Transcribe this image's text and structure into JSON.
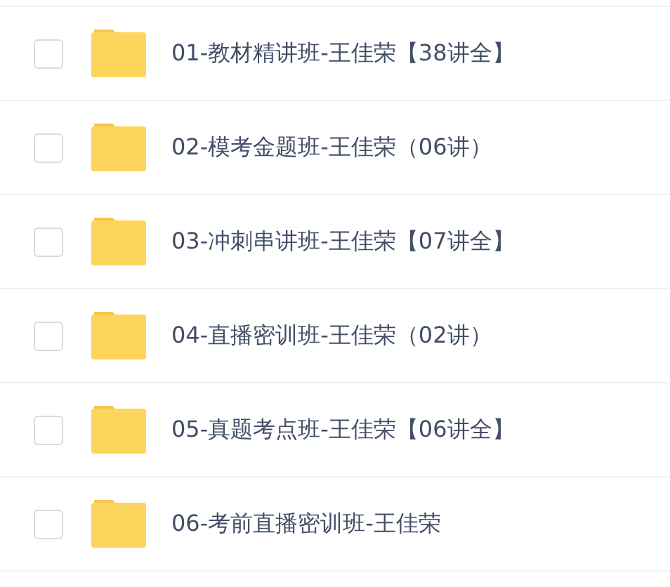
{
  "files": [
    {
      "name": "01-教材精讲班-王佳荣【38讲全】",
      "checked": false
    },
    {
      "name": "02-模考金题班-王佳荣（06讲）",
      "checked": false
    },
    {
      "name": "03-冲刺串讲班-王佳荣【07讲全】",
      "checked": false
    },
    {
      "name": "04-直播密训班-王佳荣（02讲）",
      "checked": false
    },
    {
      "name": "05-真题考点班-王佳荣【06讲全】",
      "checked": false
    },
    {
      "name": "06-考前直播密训班-王佳荣",
      "checked": false
    }
  ]
}
